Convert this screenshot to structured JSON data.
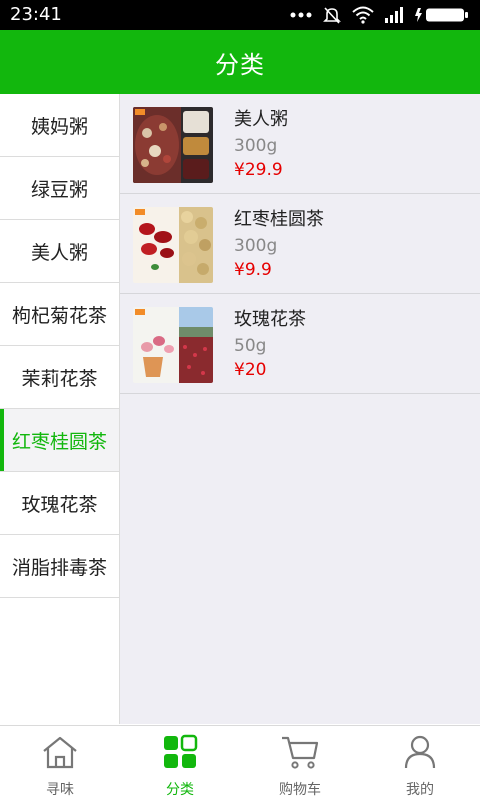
{
  "status_bar": {
    "time": "23:41"
  },
  "header": {
    "title": "分类"
  },
  "sidebar": {
    "items": [
      {
        "label": "姨妈粥"
      },
      {
        "label": "绿豆粥"
      },
      {
        "label": "美人粥"
      },
      {
        "label": "枸杞菊花茶"
      },
      {
        "label": "茉莉花茶"
      },
      {
        "label": "红枣桂圆茶"
      },
      {
        "label": "玫瑰花茶"
      },
      {
        "label": "消脂排毒茶"
      }
    ],
    "active_index": 5
  },
  "products": [
    {
      "name": "美人粥",
      "weight": "300g",
      "price": "¥29.9"
    },
    {
      "name": "红枣桂圆茶",
      "weight": "300g",
      "price": "¥9.9"
    },
    {
      "name": "玫瑰花茶",
      "weight": "50g",
      "price": "¥20"
    }
  ],
  "tabbar": {
    "tabs": [
      {
        "label": "寻味",
        "icon": "home-icon"
      },
      {
        "label": "分类",
        "icon": "category-grid-icon"
      },
      {
        "label": "购物车",
        "icon": "cart-icon"
      },
      {
        "label": "我的",
        "icon": "user-icon"
      }
    ],
    "active_index": 1
  },
  "colors": {
    "accent": "#12b70d",
    "price": "#e60000",
    "content_bg": "#efeef4"
  }
}
